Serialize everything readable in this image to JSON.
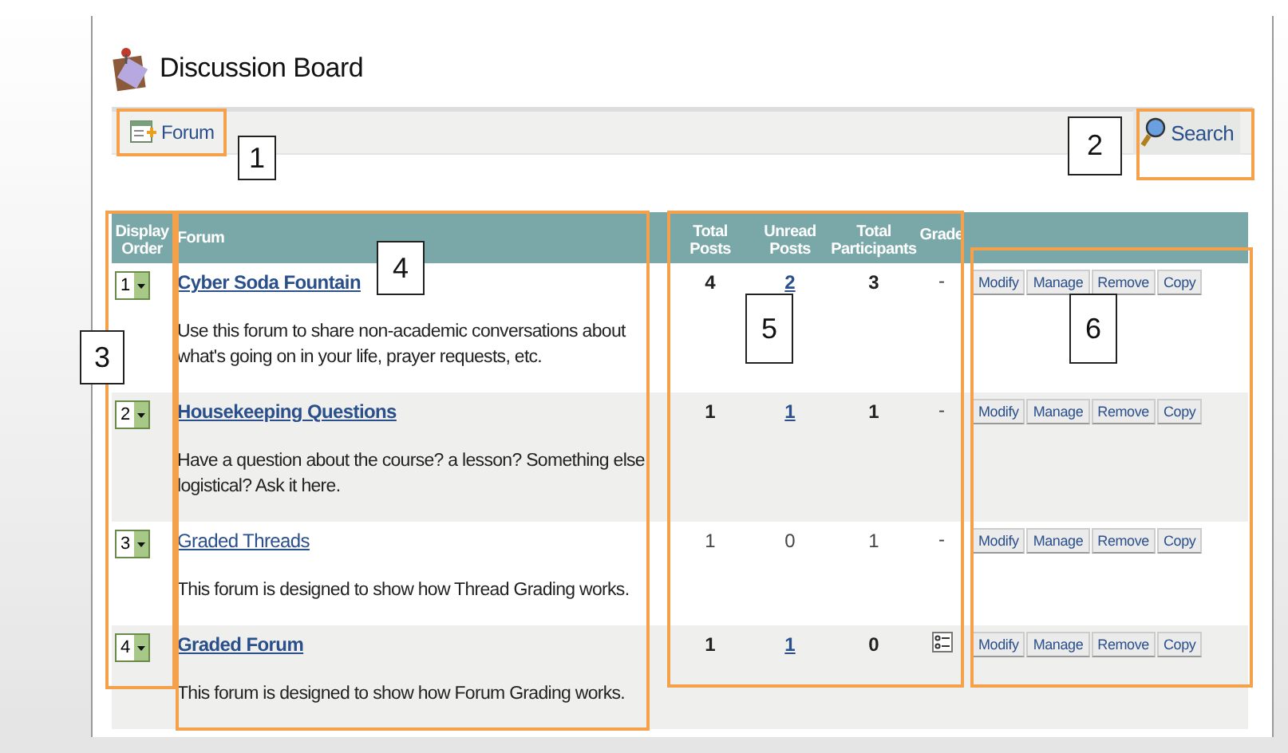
{
  "page": {
    "title": "Discussion Board"
  },
  "toolbar": {
    "add_button": "Forum",
    "search_button": "Search"
  },
  "table": {
    "columns": [
      "Display Order",
      "Forum",
      "Total Posts",
      "Unread Posts",
      "Total Participants",
      "Grade"
    ],
    "rows": [
      {
        "order": "1",
        "name": "Cyber Soda Fountain",
        "description": "Use this forum to share non-academic conversations about what's going on in your life, prayer requests, etc.",
        "unread": true,
        "total_posts": "4",
        "unread_posts": "2",
        "participants": "3",
        "grade": {
          "kind": "text",
          "text": "-"
        },
        "actions": [
          "Modify",
          "Manage",
          "Remove",
          "Copy"
        ]
      },
      {
        "order": "2",
        "name": "Housekeeping Questions",
        "description": "Have a question about the course? a lesson? Something else logistical? Ask it here.",
        "unread": true,
        "total_posts": "1",
        "unread_posts": "1",
        "participants": "1",
        "grade": {
          "kind": "text",
          "text": "-"
        },
        "actions": [
          "Modify",
          "Manage",
          "Remove",
          "Copy"
        ]
      },
      {
        "order": "3",
        "name": "Graded Threads",
        "description": "This forum is designed to show how Thread Grading works.",
        "unread": false,
        "total_posts": "1",
        "unread_posts": "0",
        "participants": "1",
        "grade": {
          "kind": "text",
          "text": "-"
        },
        "actions": [
          "Modify",
          "Manage",
          "Remove",
          "Copy"
        ]
      },
      {
        "order": "4",
        "name": "Graded Forum",
        "description": "This forum is designed to show how Forum Grading works.",
        "unread": true,
        "total_posts": "1",
        "unread_posts": "1",
        "participants": "0",
        "grade": {
          "kind": "icon"
        },
        "actions": [
          "Modify",
          "Manage",
          "Remove",
          "Copy"
        ]
      }
    ]
  },
  "callouts": [
    {
      "label": "1"
    },
    {
      "label": "2"
    },
    {
      "label": "3"
    },
    {
      "label": "4"
    },
    {
      "label": "5"
    },
    {
      "label": "6"
    }
  ]
}
